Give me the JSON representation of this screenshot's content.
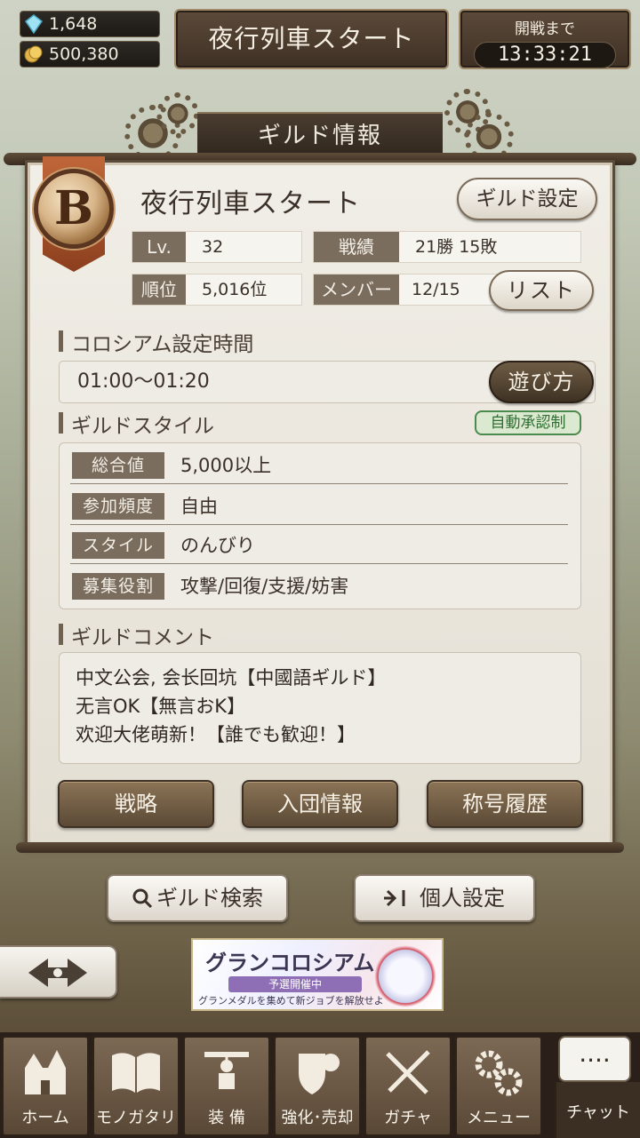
{
  "resources": {
    "gems": "1,648",
    "coins": "500,380"
  },
  "header": {
    "guild_name": "夜行列車スタート",
    "timer_label": "開戦まで",
    "timer_value": "13:33:21"
  },
  "title": "ギルド情報",
  "guild": {
    "rank": "B",
    "name": "夜行列車スタート",
    "settings_label": "ギルド設定",
    "level_label": "Lv.",
    "level": "32",
    "record_label": "戦績",
    "record": "21勝 15敗",
    "rank_label": "順位",
    "ranking": "5,016位",
    "member_label": "メンバー",
    "members": "12/15",
    "list_label": "リスト"
  },
  "colosseum": {
    "heading": "コロシアム設定時間",
    "time": "01:00〜01:20",
    "howto_label": "遊び方"
  },
  "style": {
    "heading": "ギルドスタイル",
    "auto_badge": "自動承認制",
    "rows": [
      {
        "label": "総合値",
        "value": "5,000以上"
      },
      {
        "label": "参加頻度",
        "value": "自由"
      },
      {
        "label": "スタイル",
        "value": "のんびり"
      },
      {
        "label": "募集役割",
        "value": "攻撃/回復/支援/妨害"
      }
    ]
  },
  "comment": {
    "heading": "ギルドコメント",
    "lines": [
      "中文公会, 会长回坑【中國語ギルド】",
      "无言OK【無言おK】",
      "欢迎大佬萌新！【誰でも歓迎！】"
    ]
  },
  "actions": {
    "strategy": "戦略",
    "join_info": "入団情報",
    "title_history": "称号履歴"
  },
  "lower": {
    "search_label": "ギルド検索",
    "personal_label": "個人設定"
  },
  "banner": {
    "title": "グランコロシアム",
    "sub": "予選開催中",
    "caption": "グランメダルを集めて新ジョブを解放せよ"
  },
  "nav": {
    "home": "ホーム",
    "story": "モノガタリ",
    "equip": "装 備",
    "enhance": "強化･売却",
    "gacha": "ガチャ",
    "menu": "メニュー",
    "chat": "チャット",
    "chat_bubble": "...."
  }
}
